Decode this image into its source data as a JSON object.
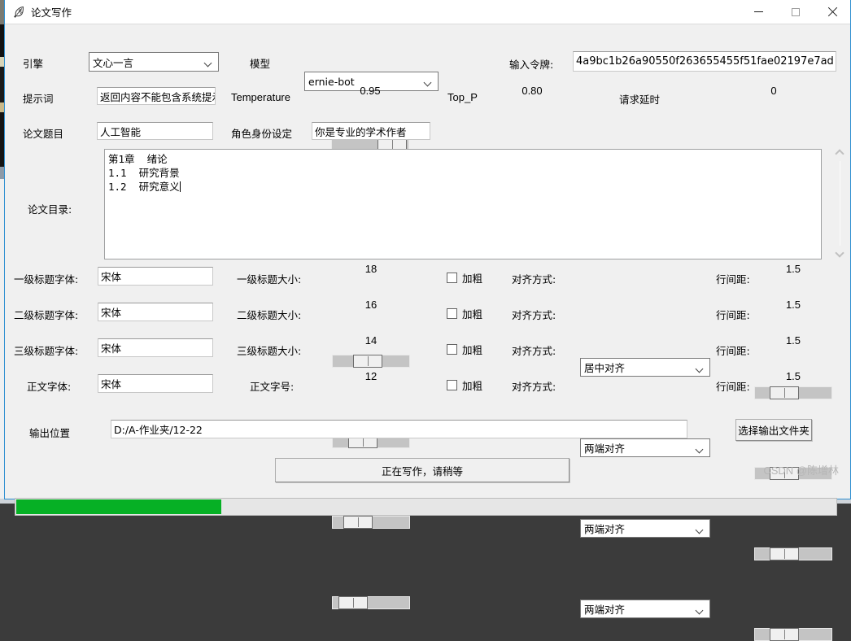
{
  "window": {
    "title": "论文写作",
    "icon": "feather-icon",
    "controls": {
      "minimize": "minimize-icon",
      "maximize": "maximize-icon",
      "close": "close-icon"
    }
  },
  "form": {
    "engine_label": "引擎",
    "engine_value": "文心一言",
    "model_label": "模型",
    "model_value": "ernie-bot",
    "token_label": "输入令牌:",
    "token_value": "4a9bc1b26a90550f263655455f51fae02197e7ad",
    "prompt_label": "提示词",
    "prompt_value": "返回内容不能包含系统提示",
    "temperature_label": "Temperature",
    "temperature_value": "0.95",
    "top_p_label": "Top_P",
    "top_p_value": "0.80",
    "delay_label": "请求延时",
    "delay_value": "0",
    "topic_label": "论文题目",
    "topic_value": "人工智能",
    "role_label": "角色身份设定",
    "role_value": "你是专业的学术作者",
    "outline_label": "论文目录:",
    "outline_value": "第1章  绪论\n1.1  研究背景\n1.2  研究意义"
  },
  "style_rows": [
    {
      "font_label": "一级标题字体:",
      "font_value": "宋体",
      "size_label": "一级标题大小:",
      "size_value": "18",
      "bold_label": "加粗",
      "bold_checked": false,
      "align_label": "对齐方式:",
      "align_value": "居中对齐",
      "spacing_label": "行间距:",
      "spacing_value": "1.5"
    },
    {
      "font_label": "二级标题字体:",
      "font_value": "宋体",
      "size_label": "二级标题大小:",
      "size_value": "16",
      "bold_label": "加粗",
      "bold_checked": false,
      "align_label": "对齐方式:",
      "align_value": "两端对齐",
      "spacing_label": "行间距:",
      "spacing_value": "1.5"
    },
    {
      "font_label": "三级标题字体:",
      "font_value": "宋体",
      "size_label": "三级标题大小:",
      "size_value": "14",
      "bold_label": "加粗",
      "bold_checked": false,
      "align_label": "对齐方式:",
      "align_value": "两端对齐",
      "spacing_label": "行间距:",
      "spacing_value": "1.5"
    },
    {
      "font_label": "正文字体:",
      "font_value": "宋体",
      "size_label": "正文字号:",
      "size_value": "12",
      "bold_label": "加粗",
      "bold_checked": false,
      "align_label": "对齐方式:",
      "align_value": "两端对齐",
      "spacing_label": "行间距:",
      "spacing_value": "1.5"
    }
  ],
  "output": {
    "path_label": "输出位置",
    "path_value": "D:/A-作业夹/12-22",
    "choose_button": "选择输出文件夹",
    "action_button": "正在写作，请稍等",
    "progress_percent": 25
  },
  "watermark": "CSDN @陈增林",
  "colors": {
    "accent": "#2e8fd1",
    "progress": "#06b025",
    "window_bg": "#f0f0f0",
    "field_bg": "#ffffff"
  }
}
